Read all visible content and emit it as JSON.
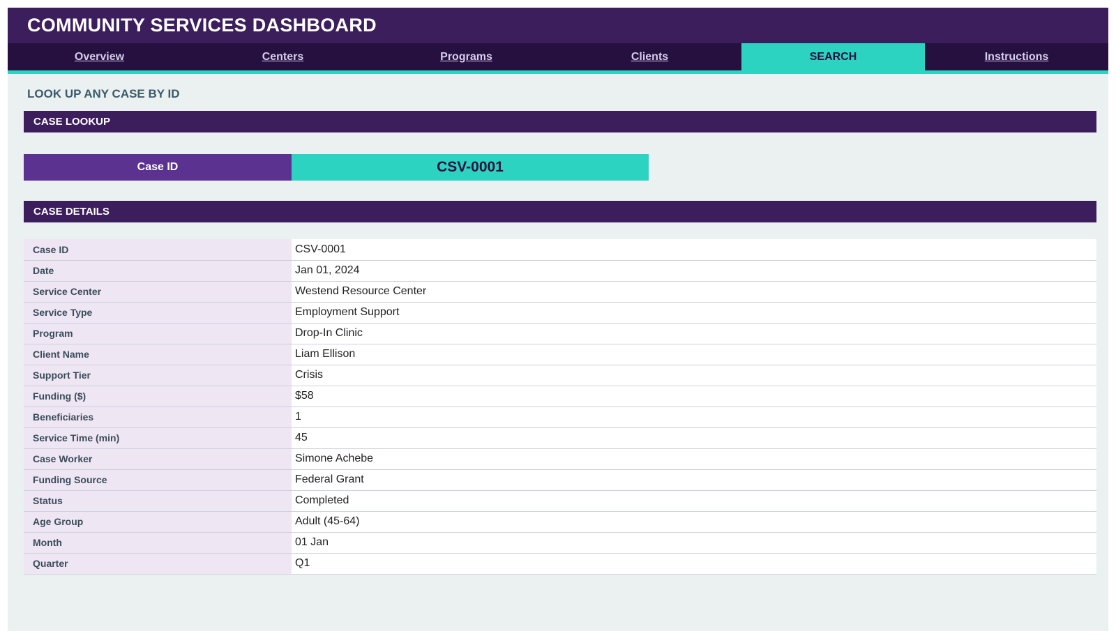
{
  "header": {
    "title": "COMMUNITY SERVICES DASHBOARD"
  },
  "nav": {
    "tabs": [
      {
        "label": "Overview"
      },
      {
        "label": "Centers"
      },
      {
        "label": "Programs"
      },
      {
        "label": "Clients"
      },
      {
        "label": "SEARCH"
      },
      {
        "label": "Instructions"
      }
    ],
    "active_tab": "SEARCH"
  },
  "page": {
    "heading": "LOOK UP ANY CASE BY ID"
  },
  "lookup": {
    "section_title": "CASE LOOKUP",
    "label": "Case ID",
    "value": "CSV-0001"
  },
  "details": {
    "section_title": "CASE DETAILS",
    "rows": [
      {
        "key": "Case ID",
        "value": "CSV-0001"
      },
      {
        "key": "Date",
        "value": "Jan 01, 2024"
      },
      {
        "key": "Service Center",
        "value": "Westend Resource Center"
      },
      {
        "key": "Service Type",
        "value": "Employment Support"
      },
      {
        "key": "Program",
        "value": "Drop-In Clinic"
      },
      {
        "key": "Client Name",
        "value": "Liam Ellison"
      },
      {
        "key": "Support Tier",
        "value": "Crisis"
      },
      {
        "key": "Funding ($)",
        "value": "$58"
      },
      {
        "key": "Beneficiaries",
        "value": "1"
      },
      {
        "key": "Service Time (min)",
        "value": "45"
      },
      {
        "key": "Case Worker",
        "value": "Simone Achebe"
      },
      {
        "key": "Funding Source",
        "value": "Federal Grant"
      },
      {
        "key": "Status",
        "value": "Completed"
      },
      {
        "key": "Age Group",
        "value": "Adult (45-64)"
      },
      {
        "key": "Month",
        "value": "01 Jan"
      },
      {
        "key": "Quarter",
        "value": "Q1"
      }
    ]
  },
  "colors": {
    "brand_purple": "#3c1e5c",
    "nav_dark": "#26103f",
    "accent_teal": "#2dd3c1",
    "label_purple": "#5b3290",
    "background": "#ebf1f1",
    "key_cell": "#efe6f4"
  }
}
